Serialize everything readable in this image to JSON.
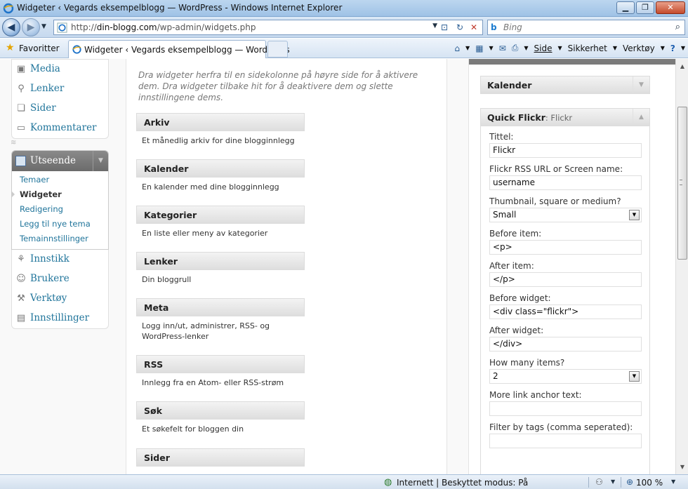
{
  "window": {
    "title": "Widgeter ‹ Vegards eksempelblogg — WordPress - Windows Internet Explorer",
    "minimize": "▁",
    "restore": "❐",
    "close": "✕"
  },
  "address": {
    "url_prefix": "http://",
    "url_host": "din-blogg.com",
    "url_path": "/wp-admin/widgets.php",
    "search_placeholder": "Bing"
  },
  "favorites": {
    "label": "Favoritter",
    "tab_title": "Widgeter ‹ Vegards eksempelblogg — WordPress"
  },
  "commandbar": {
    "page": "Side",
    "safety": "Sikkerhet",
    "tools": "Verktøy"
  },
  "adminmenu": {
    "top_items": [
      {
        "label": "Media",
        "icon": "media-icon"
      },
      {
        "label": "Lenker",
        "icon": "links-icon"
      },
      {
        "label": "Sider",
        "icon": "pages-icon"
      },
      {
        "label": "Kommentarer",
        "icon": "comments-icon"
      }
    ],
    "appearance": {
      "label": "Utseende",
      "submenu": [
        "Temaer",
        "Widgeter",
        "Redigering",
        "Legg til nye tema",
        "Temainnstillinger"
      ],
      "current": "Widgeter"
    },
    "bottom_items": [
      {
        "label": "Innstikk",
        "icon": "plugins-icon"
      },
      {
        "label": "Brukere",
        "icon": "users-icon"
      },
      {
        "label": "Verktøy",
        "icon": "tools-icon"
      },
      {
        "label": "Innstillinger",
        "icon": "settings-icon"
      }
    ]
  },
  "available": {
    "description": "Dra widgeter herfra til en sidekolonne på høyre side for å aktivere dem. Dra widgeter tilbake hit for å deaktivere dem og slette innstillingene dems.",
    "widgets": [
      {
        "title": "Arkiv",
        "desc": "Et månedlig arkiv for dine blogginnlegg"
      },
      {
        "title": "Kalender",
        "desc": "En kalender med dine blogginnlegg"
      },
      {
        "title": "Kategorier",
        "desc": "En liste eller meny av kategorier"
      },
      {
        "title": "Lenker",
        "desc": "Din bloggrull"
      },
      {
        "title": "Meta",
        "desc": "Logg inn/ut, administrer, RSS- og WordPress-lenker"
      },
      {
        "title": "RSS",
        "desc": "Innlegg fra en Atom- eller RSS-strøm"
      },
      {
        "title": "Søk",
        "desc": "Et søkefelt for bloggen din"
      },
      {
        "title": "Sider",
        "desc": ""
      }
    ]
  },
  "sidebar": {
    "kalender_title": "Kalender",
    "flickr_title": "Quick Flickr",
    "flickr_subtitle": ": Flickr",
    "fields": [
      {
        "label": "Tittel:",
        "value": "Flickr",
        "type": "text"
      },
      {
        "label": "Flickr RSS URL or Screen name:",
        "value": "username",
        "type": "text"
      },
      {
        "label": "Thumbnail, square or medium?",
        "value": "Small",
        "type": "select"
      },
      {
        "label": "Before item:",
        "value": "<p>",
        "type": "text"
      },
      {
        "label": "After item:",
        "value": "</p>",
        "type": "text"
      },
      {
        "label": "Before widget:",
        "value": "<div class=\"flickr\">",
        "type": "text"
      },
      {
        "label": "After widget:",
        "value": "</div>",
        "type": "text"
      },
      {
        "label": "How many items?",
        "value": "2",
        "type": "select"
      },
      {
        "label": "More link anchor text:",
        "value": "",
        "type": "text"
      },
      {
        "label": "Filter by tags (comma seperated):",
        "value": "",
        "type": "text"
      }
    ]
  },
  "status": {
    "zone": "Internett | Beskyttet modus: På",
    "zoom": "100 %"
  }
}
